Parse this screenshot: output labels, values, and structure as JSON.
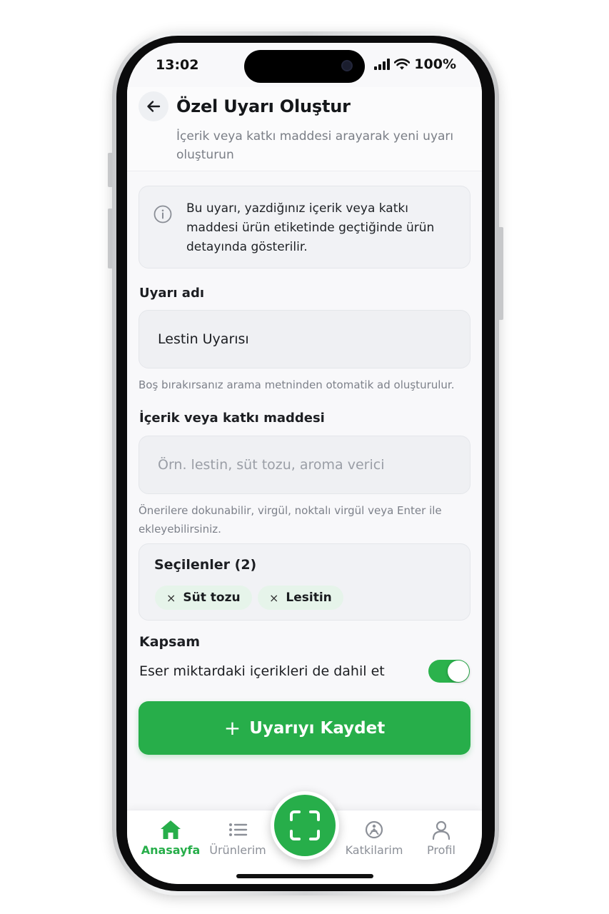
{
  "status_bar": {
    "time": "13:02",
    "battery": "100%"
  },
  "header": {
    "title": "Özel Uyarı Oluştur",
    "subtitle": "İçerik veya katkı maddesi arayarak yeni uyarı oluşturun"
  },
  "info": {
    "text": "Bu uyarı, yazdiğınız içerik veya katkı maddesi ürün etiketinde geçtiğinde ürün detayında gösterilir."
  },
  "alert_name": {
    "label": "Uyarı adı",
    "value": "Lestin Uyarısı",
    "helper": "Boş bırakırsanız arama metninden otomatik ad oluşturulur."
  },
  "ingredient": {
    "label": "İçerik veya katkı maddesi",
    "placeholder": "Örn. lestin, süt tozu, aroma verici",
    "helper": "Önerilere dokunabilir, virgül, noktalı virgül veya Enter ile ekleyebilirsiniz."
  },
  "selected": {
    "title": "Seçilenler (2)",
    "chips": [
      "Süt tozu",
      "Lesitin"
    ],
    "remove_symbol": "×"
  },
  "scope": {
    "label": "Kapsam",
    "toggle_label": "Eser miktardaki içerikleri de dahil et",
    "toggle_on": true
  },
  "save_button": {
    "label": "Uyarıyı Kaydet",
    "icon": "+"
  },
  "nav": {
    "items": [
      {
        "label": "Anasayfa",
        "icon": "home-icon",
        "active": true
      },
      {
        "label": "Ürünlerim",
        "icon": "list-icon",
        "active": false
      },
      {
        "label": "Katkilarim",
        "icon": "additive-icon",
        "active": false
      },
      {
        "label": "Profil",
        "icon": "user-icon",
        "active": false
      }
    ],
    "scan_icon": "scan-icon"
  },
  "colors": {
    "accent": "#27ae4a",
    "chip_bg": "#e6f4ea",
    "muted_text": "#7d818a"
  }
}
